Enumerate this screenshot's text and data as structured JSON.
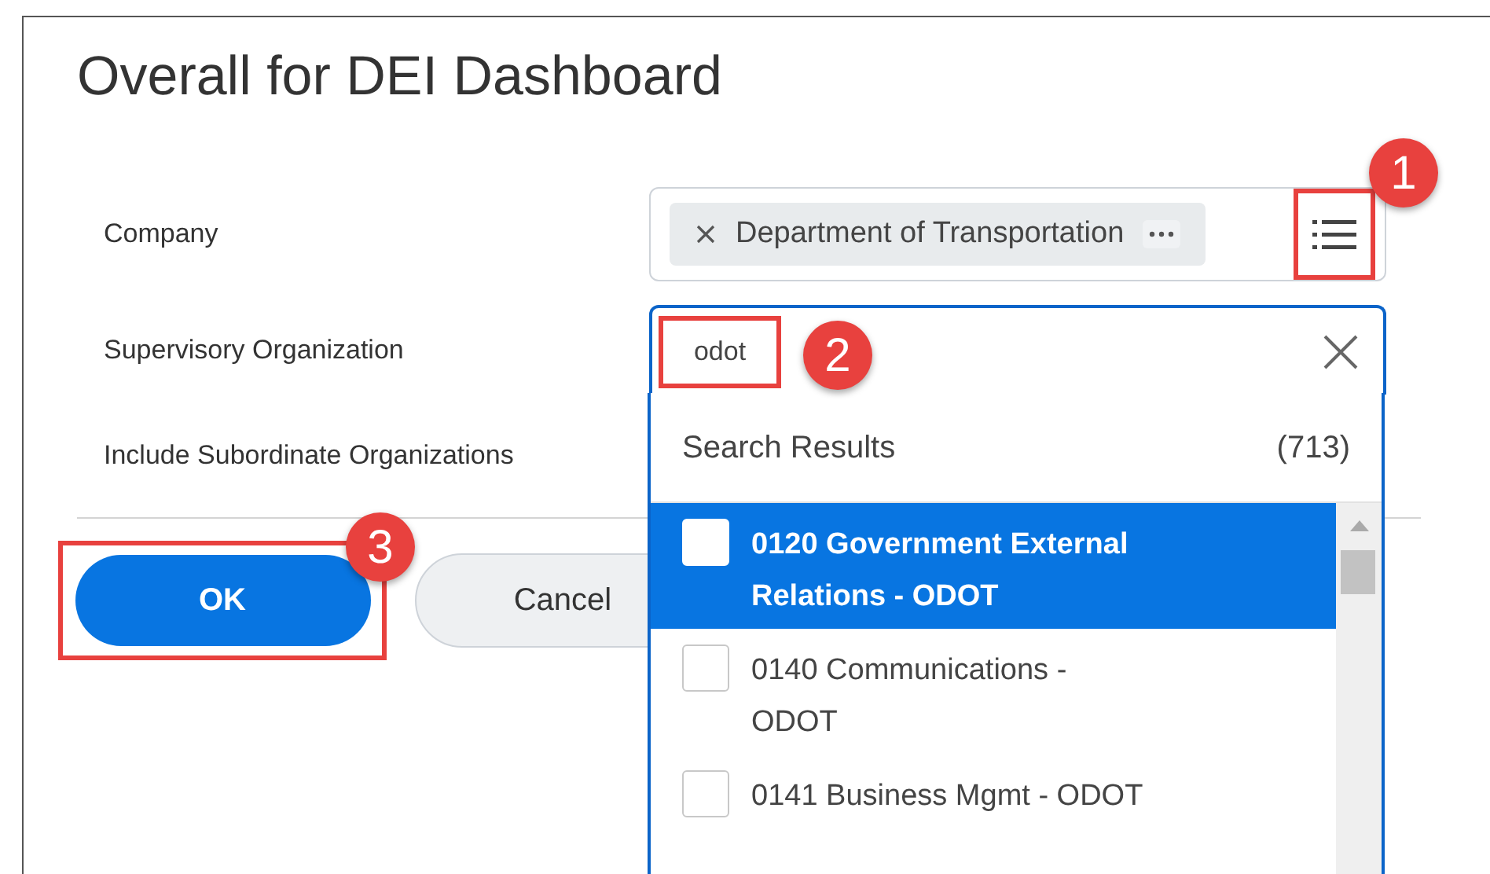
{
  "dialog": {
    "title": "Overall for DEI Dashboard"
  },
  "fields": [
    {
      "label": "Company"
    },
    {
      "label": "Supervisory Organization"
    },
    {
      "label": "Include Subordinate Organizations"
    }
  ],
  "company_field": {
    "chip": "Department of Transportation"
  },
  "search_field": {
    "value": "odot"
  },
  "search_results": {
    "title": "Search Results",
    "count": "(713)",
    "items": [
      {
        "label": "0120 Government External Relations - ODOT",
        "selected": true,
        "checked": false
      },
      {
        "label": "0140 Communications - ODOT",
        "selected": false,
        "checked": false
      },
      {
        "label": "0141 Business Mgmt - ODOT",
        "selected": false,
        "checked": false
      }
    ]
  },
  "buttons": [
    {
      "label": "OK",
      "kind": "primary"
    },
    {
      "label": "Cancel",
      "kind": "secondary"
    }
  ],
  "callouts": [
    "1",
    "2",
    "3"
  ]
}
